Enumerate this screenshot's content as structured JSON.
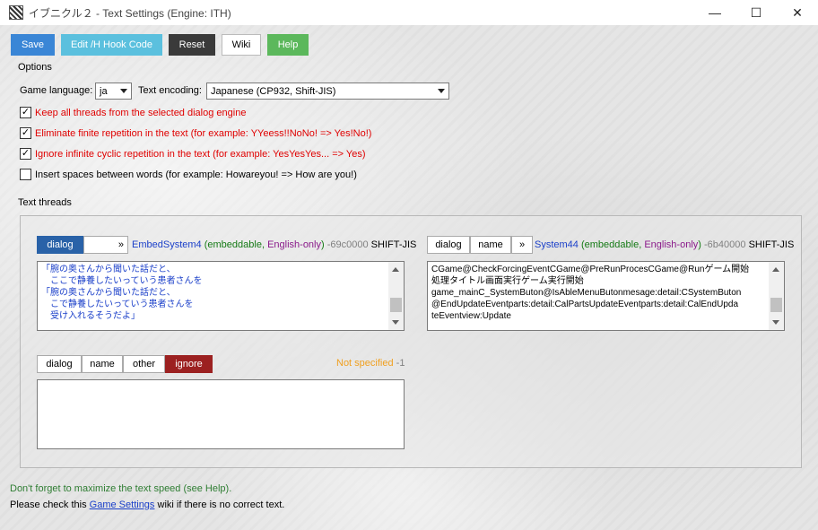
{
  "window": {
    "title": "イブニクル２ - Text Settings (Engine: ITH)",
    "minimize": "—",
    "maximize": "☐",
    "close": "✕",
    "icon": "app-icon"
  },
  "toolbar": {
    "save": "Save",
    "edit_hook": "Edit /H Hook Code",
    "reset": "Reset",
    "wiki": "Wiki",
    "help": "Help"
  },
  "options": {
    "heading": "Options",
    "game_language_label": "Game language:",
    "game_language_value": "ja",
    "text_encoding_label": "Text encoding:",
    "text_encoding_value": "Japanese (CP932, Shift-JIS)",
    "checkboxes": [
      {
        "label": "Keep all threads from the selected dialog engine",
        "checked": "✓"
      },
      {
        "label": "Eliminate finite repetition in the text (for example: YYeess!!NoNo! => Yes!No!)",
        "checked": "✓"
      },
      {
        "label": "Ignore infinite cyclic repetition in the text (for example: YesYesYes... => Yes)",
        "checked": "✓"
      },
      {
        "label": "Insert spaces between words (for example: Howareyou! => How are you!)",
        "checked": ""
      }
    ]
  },
  "threads": {
    "heading": "Text threads",
    "thread1": {
      "tab_dialog": "dialog",
      "tab_more": "»",
      "name": "EmbedSystem4",
      "open_paren": "(",
      "embeddable": "embeddable",
      "comma": ",",
      "english_only": "English-only",
      "close_paren": ")",
      "address": "-69c0000",
      "encoding": "SHIFT-JIS",
      "text": "「腕の奥さんから聞いた話だと、\n　ここで静養したいっていう患者さんを\n「腕の奥さんから聞いた話だと、\n　こで静養したいっていう患者さんを\n　受け入れるそうだよ」"
    },
    "thread2": {
      "tab_dialog": "dialog",
      "tab_name": "name",
      "tab_more": "»",
      "name": "System44",
      "open_paren": "(",
      "embeddable": "embeddable",
      "comma": ",",
      "english_only": "English-only",
      "close_paren": ")",
      "address": "-6b40000",
      "encoding": "SHIFT-JIS",
      "text": "CGame@CheckForcingEventCGame@PreRunProcesCGame@Runゲーム開始\n処理タイトル画面実行ゲーム実行開始\ngame_mainC_SystemButon@IsAbleMenuButonmesage:detail:CSystemButon\n@EndUpdateEventparts:detail:CalPartsUpdateEventparts:detail:CalEndUpda\nteEventview:Update"
    },
    "thread3": {
      "tab_dialog": "dialog",
      "tab_name": "name",
      "tab_other": "other",
      "tab_ignore": "ignore",
      "status": "Not specified",
      "status_num": "-1",
      "text": ""
    }
  },
  "footer": {
    "tip": "Don't forget to maximize the text speed (see Help).",
    "check_prefix": "Please check this",
    "check_link": "Game Settings",
    "check_suffix": "wiki if there is no correct text."
  },
  "colors": {
    "save_bg": "#3a86d6",
    "edit_bg": "#5bc0de",
    "reset_bg": "#3a3a3a",
    "help_bg": "#5cb85c",
    "active_tab_blue": "#2962a8",
    "active_tab_red": "#9c2121"
  }
}
